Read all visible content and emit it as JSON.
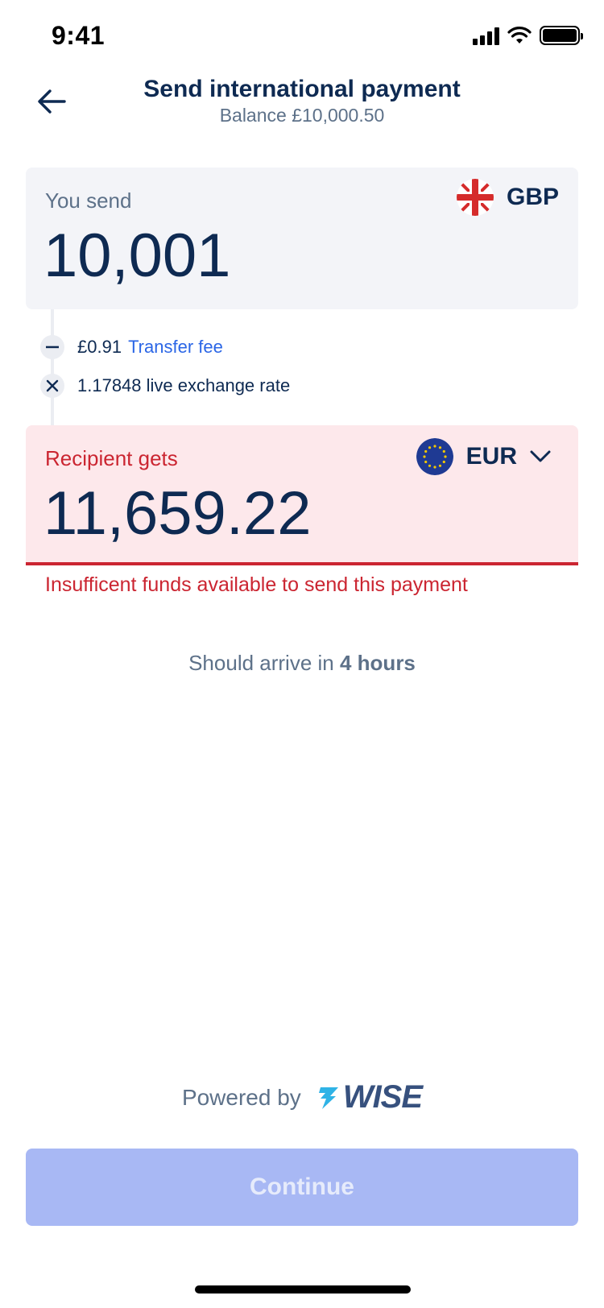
{
  "status": {
    "time": "9:41"
  },
  "header": {
    "title": "Send international payment",
    "balance": "Balance £10,000.50"
  },
  "send": {
    "label": "You send",
    "amount": "10,001",
    "currency": "GBP"
  },
  "fees": {
    "fee_amount": "£0.91",
    "fee_link": "Transfer fee",
    "rate_text": "1.17848 live exchange rate"
  },
  "receive": {
    "label": "Recipient gets",
    "amount": "11,659.22",
    "currency": "EUR"
  },
  "error": "Insufficent funds available to send this payment",
  "arrival": {
    "prefix": "Should arrive in ",
    "time": "4 hours"
  },
  "footer": {
    "powered_by": "Powered by",
    "brand": "WISE"
  },
  "continue_label": "Continue",
  "colors": {
    "navy": "#0e2a52",
    "error_red": "#cb2531",
    "link_blue": "#2b66e6",
    "button_disabled": "#a8b8f4",
    "wise_teal": "#2fb3e6"
  },
  "icons": [
    "back-arrow-icon",
    "cellular-signal-icon",
    "wifi-icon",
    "battery-icon",
    "uk-flag-icon",
    "eu-flag-icon",
    "chevron-down-icon",
    "minus-icon",
    "times-icon",
    "wise-flag-icon"
  ]
}
